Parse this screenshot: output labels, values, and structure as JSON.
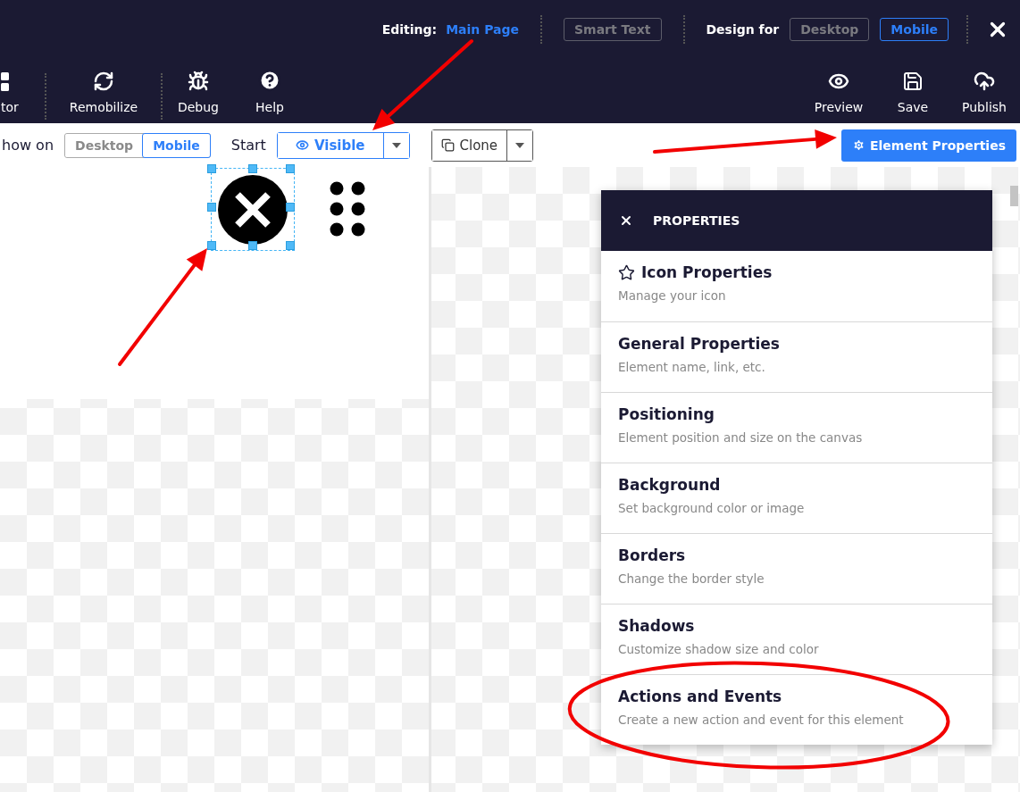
{
  "header": {
    "editing_label": "Editing:",
    "page_link": "Main Page",
    "smart_text": {
      "label": "Smart Text",
      "disabled": true
    },
    "design_for_label": "Design for",
    "design_options": [
      {
        "label": "Desktop",
        "selected": false
      },
      {
        "label": "Mobile",
        "selected": true
      }
    ]
  },
  "tools_left": [
    {
      "label": "tor",
      "kind": "partial",
      "separator_after": true
    },
    {
      "label": "Remobilize",
      "kind": "refresh",
      "separator_after": true
    },
    {
      "label": "Debug",
      "kind": "bug",
      "separator_after": false
    },
    {
      "label": "Help",
      "kind": "help",
      "separator_after": false
    }
  ],
  "tools_right": [
    {
      "label": "Preview",
      "kind": "eye"
    },
    {
      "label": "Save",
      "kind": "save"
    },
    {
      "label": "Publish",
      "kind": "upload"
    }
  ],
  "toolbar": {
    "show_on_label": "how on",
    "show_on_options": [
      {
        "label": "Desktop",
        "selected": false
      },
      {
        "label": "Mobile",
        "selected": true
      }
    ],
    "start_label": "Start",
    "visibility": "Visible",
    "clone": "Clone",
    "element_properties": "Element Properties"
  },
  "canvas": {
    "selected_icon": {
      "selected": true
    }
  },
  "panel": {
    "title": "PROPERTIES",
    "items": [
      {
        "title": "Icon Properties",
        "subtitle": "Manage your icon",
        "has_icon": true
      },
      {
        "title": "General Properties",
        "subtitle": "Element name, link, etc.",
        "has_icon": false
      },
      {
        "title": "Positioning",
        "subtitle": "Element position and size on the canvas",
        "has_icon": false
      },
      {
        "title": "Background",
        "subtitle": "Set background color or image",
        "has_icon": false
      },
      {
        "title": "Borders",
        "subtitle": "Change the border style",
        "has_icon": false
      },
      {
        "title": "Shadows",
        "subtitle": "Customize shadow size and color",
        "has_icon": false
      },
      {
        "title": "Actions and Events",
        "subtitle": "Create a new action and event for this element",
        "has_icon": false
      }
    ]
  }
}
